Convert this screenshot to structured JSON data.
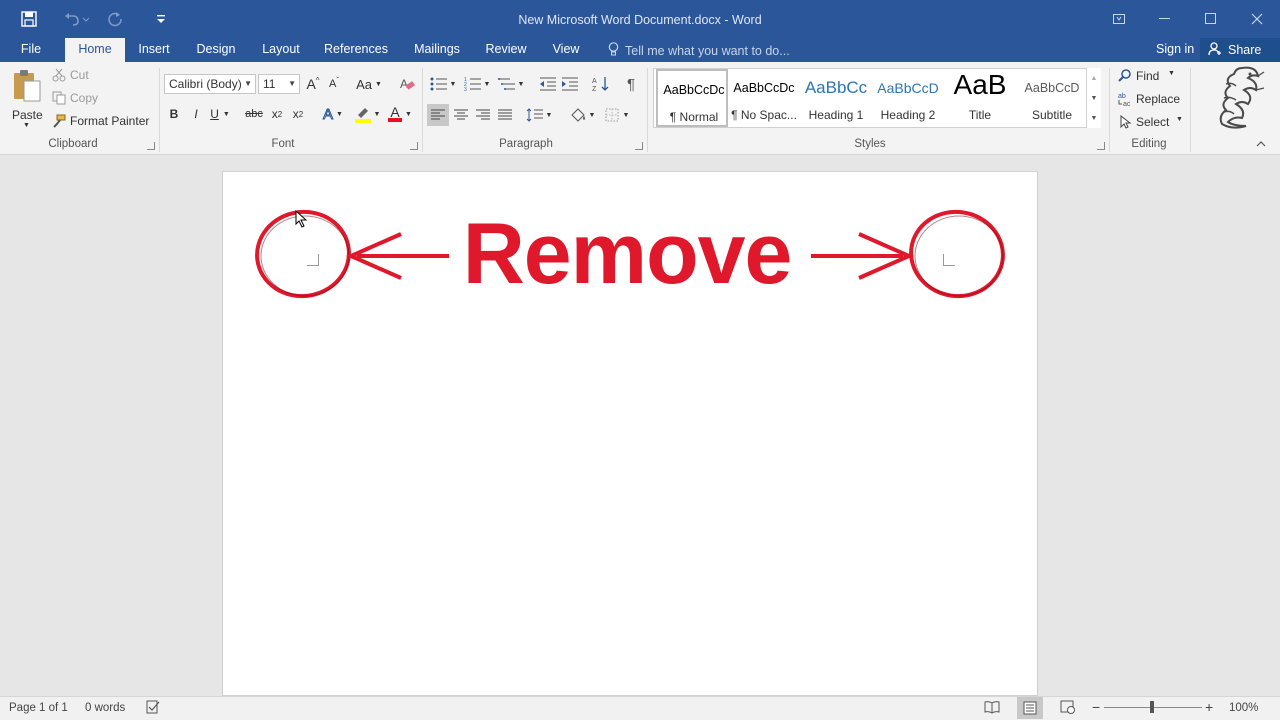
{
  "window": {
    "title": "New Microsoft Word Document.docx - Word"
  },
  "qat": {
    "icons": [
      "save-icon",
      "undo-icon",
      "redo-icon",
      "customize-icon"
    ]
  },
  "tabs": [
    {
      "label": "File"
    },
    {
      "label": "Home"
    },
    {
      "label": "Insert"
    },
    {
      "label": "Design"
    },
    {
      "label": "Layout"
    },
    {
      "label": "References"
    },
    {
      "label": "Mailings"
    },
    {
      "label": "Review"
    },
    {
      "label": "View"
    }
  ],
  "tellme": "Tell me what you want to do...",
  "signin": "Sign in",
  "share": "Share",
  "clipboard": {
    "paste": "Paste",
    "cut": "Cut",
    "copy": "Copy",
    "format_painter": "Format Painter",
    "label": "Clipboard"
  },
  "font": {
    "name": "Calibri (Body)",
    "size": "11",
    "label": "Font",
    "change_case": "Aa",
    "grow": "A",
    "shrink": "A",
    "bold": "B",
    "italic": "I",
    "underline": "U",
    "strike": "abc",
    "subscript": "x",
    "superscript": "x",
    "sub_mark": "2",
    "sup_mark": "2",
    "text_effects": "A",
    "font_color": "A",
    "colors": {
      "highlight": "#ffff00",
      "font_color": "#e81123",
      "text_effects": "#2b579a"
    }
  },
  "paragraph": {
    "label": "Paragraph"
  },
  "styles": {
    "label": "Styles",
    "items": [
      {
        "preview": "AaBbCcDc",
        "name": "¶ Normal",
        "color": "#000000"
      },
      {
        "preview": "AaBbCcDc",
        "name": "¶ No Spac...",
        "color": "#000000"
      },
      {
        "preview": "AaBbCc",
        "name": "Heading 1",
        "color": "#2e74b5"
      },
      {
        "preview": "AaBbCcD",
        "name": "Heading 2",
        "color": "#2e74b5"
      },
      {
        "preview": "AaB",
        "name": "Title",
        "color": "#000000"
      },
      {
        "preview": "AaBbCcD",
        "name": "Subtitle",
        "color": "#595959"
      }
    ]
  },
  "editing": {
    "find": "Find",
    "replace": "Replace",
    "select": "Select",
    "label": "Editing"
  },
  "overlay": {
    "text": "Remove",
    "color": "#e0182b"
  },
  "status": {
    "page": "Page 1 of 1",
    "words": "0 words",
    "zoom": "100%"
  }
}
